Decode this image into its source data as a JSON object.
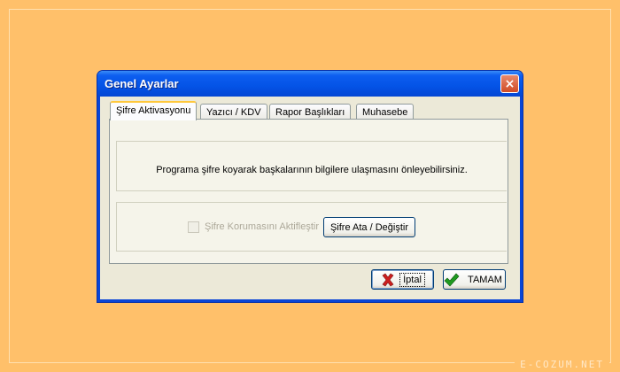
{
  "window": {
    "title": "Genel Ayarlar",
    "close_glyph": "×"
  },
  "tabs": [
    {
      "label": "Şifre Aktivasyonu",
      "active": true
    },
    {
      "label": "Yazıcı / KDV",
      "active": false
    },
    {
      "label": "Rapor Başlıkları",
      "active": false
    },
    {
      "label": "Muhasebe",
      "active": false
    }
  ],
  "password_tab": {
    "info_text": "Programa şifre koyarak başkalarının bilgilere ulaşmasını önleyebilirsiniz.",
    "checkbox_label": "Şifre Korumasını Aktifleştir",
    "checkbox_checked": false,
    "checkbox_enabled": false,
    "set_password_button": "Şifre Ata / Değiştir"
  },
  "footer": {
    "cancel_label": "İptal",
    "ok_label": "TAMAM"
  },
  "icons": {
    "cancel": "red-x-icon",
    "ok": "green-check-icon"
  },
  "colors": {
    "background": "#ffc06a",
    "titlebar": "#0453e6",
    "dialog": "#ece9d8",
    "active_tab_accent": "#ffc83c",
    "cancel_icon": "#cc1f1f",
    "ok_icon": "#1f9a1f"
  },
  "watermark": "E-COZUM.NET"
}
